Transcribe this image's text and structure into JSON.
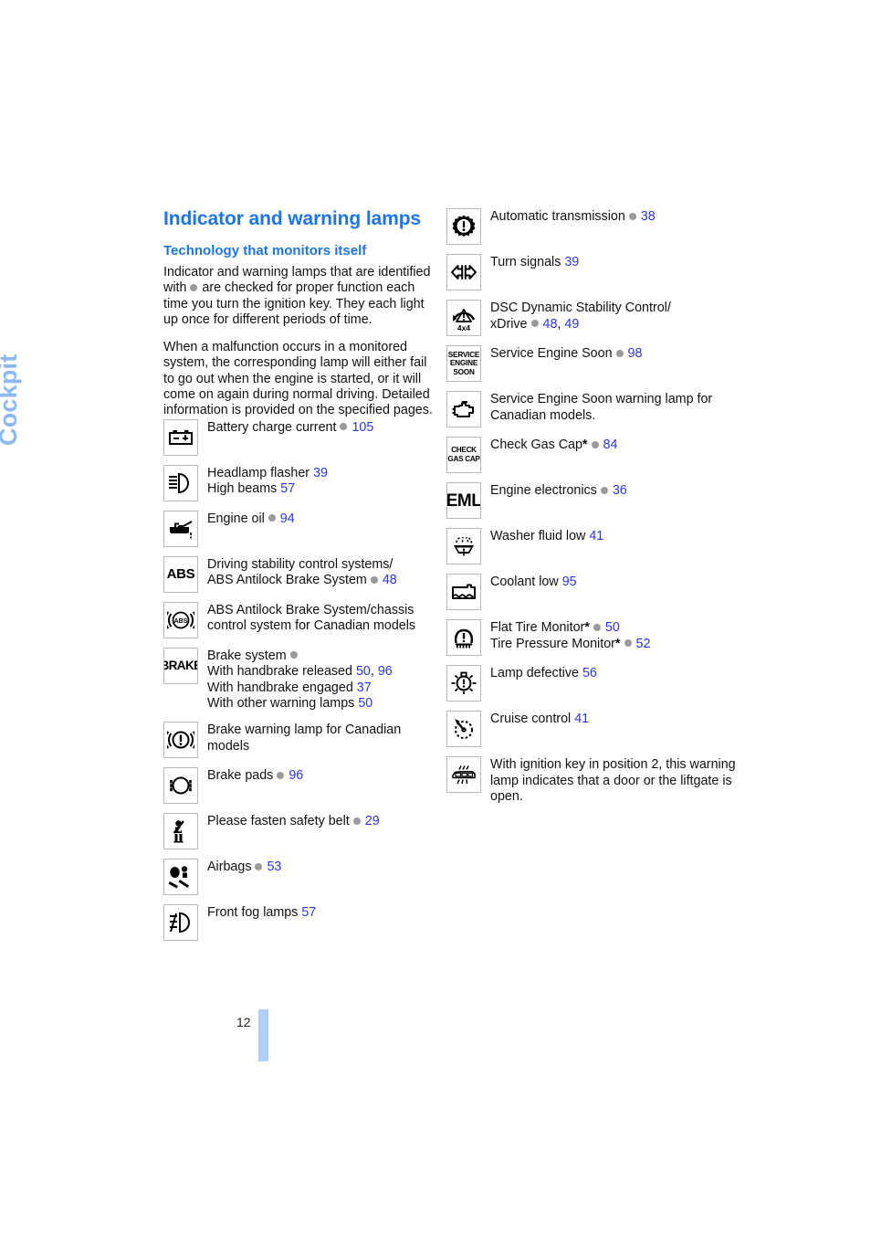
{
  "chapter_tab": "Cockpit",
  "page_number": "12",
  "colors": {
    "heading_blue": "#1E74EA",
    "page_ref_blue": "#2A36DE",
    "tab_blue": "#8CB9F2",
    "footer_bar_blue": "#AFD0F7",
    "bullet_gray": "#9a9a9a"
  },
  "intro": {
    "title": "Indicator and warning lamps",
    "subtitle": "Technology that monitors itself",
    "paragraph1_a": "Indicator and warning lamps that are identified with",
    "paragraph1_b": "are checked for proper function each time you turn the ignition key. They each light up once for different periods of time.",
    "paragraph2": "When a malfunction occurs in a monitored system, the corresponding lamp will either fail to go out when the engine is started, or it will come on again during normal driving. Detailed information is provided on the specified pages."
  },
  "left_column": [
    {
      "icon": "battery-charge-icon",
      "icon_kind": "battery",
      "lines": [
        {
          "label": "Battery charge current",
          "dot": true,
          "pages": "105"
        }
      ]
    },
    {
      "icon": "headlamp-flasher-icon",
      "icon_kind": "headlamp",
      "lines": [
        {
          "label": "Headlamp flasher",
          "dot": false,
          "pages": "39"
        },
        {
          "label": "High beams",
          "dot": false,
          "pages": "57"
        }
      ]
    },
    {
      "icon": "engine-oil-icon",
      "icon_kind": "oilcan",
      "lines": [
        {
          "label": "Engine oil",
          "dot": true,
          "pages": "94"
        }
      ]
    },
    {
      "icon": "abs-text-icon",
      "icon_kind": "text",
      "icon_text": "ABS",
      "icon_text_class": "g-abs",
      "lines": [
        {
          "label": "Driving stability control systems/",
          "dot": false,
          "pages": ""
        },
        {
          "label": "ABS Antilock Brake System",
          "dot": true,
          "pages": "48"
        }
      ]
    },
    {
      "icon": "abs-circle-icon",
      "icon_kind": "abs-circle",
      "lines": [
        {
          "label": "ABS Antilock Brake System/chassis control system for Canadian models",
          "dot": false,
          "pages": ""
        }
      ]
    },
    {
      "icon": "brake-text-icon",
      "icon_kind": "text",
      "icon_text": "BRAKE",
      "icon_text_class": "g-brake",
      "lines": [
        {
          "label": "Brake system",
          "dot": true,
          "pages": ""
        },
        {
          "label": "With handbrake released",
          "dot": false,
          "pages": "50, 96"
        },
        {
          "label": "With handbrake engaged",
          "dot": false,
          "pages": "37"
        },
        {
          "label": "With other warning lamps",
          "dot": false,
          "pages": "50"
        }
      ]
    },
    {
      "icon": "brake-warning-canadian-icon",
      "icon_kind": "brake-exclaim",
      "lines": [
        {
          "label": "Brake warning lamp for Canadian models",
          "dot": false,
          "pages": ""
        }
      ]
    },
    {
      "icon": "brake-pads-icon",
      "icon_kind": "brake-pads",
      "lines": [
        {
          "label": "Brake pads",
          "dot": true,
          "pages": "96"
        }
      ]
    },
    {
      "icon": "safety-belt-icon",
      "icon_kind": "seatbelt",
      "lines": [
        {
          "label": "Please fasten safety belt",
          "dot": true,
          "pages": "29"
        }
      ]
    },
    {
      "icon": "airbag-icon",
      "icon_kind": "airbag",
      "lines": [
        {
          "label": "Airbags",
          "dot": true,
          "pages": "53"
        }
      ]
    },
    {
      "icon": "front-fog-lamp-icon",
      "icon_kind": "foglamp",
      "lines": [
        {
          "label": "Front fog lamps",
          "dot": false,
          "pages": "57"
        }
      ]
    }
  ],
  "right_column": [
    {
      "icon": "automatic-transmission-icon",
      "icon_kind": "gear-exclaim",
      "lines": [
        {
          "label": "Automatic transmission",
          "dot": true,
          "pages": "38"
        }
      ]
    },
    {
      "icon": "turn-signals-icon",
      "icon_kind": "turn-signals",
      "lines": [
        {
          "label": "Turn signals",
          "dot": false,
          "pages": "39"
        }
      ]
    },
    {
      "icon": "dsc-xdrive-icon",
      "icon_kind": "dsc",
      "icon_sub": "4x4",
      "lines": [
        {
          "label": "DSC Dynamic Stability Control/",
          "dot": false,
          "pages": ""
        },
        {
          "label": "xDrive",
          "dot": true,
          "pages": "48, 49"
        }
      ]
    },
    {
      "icon": "service-engine-soon-text-icon",
      "icon_kind": "text",
      "icon_text": "SERVICE\nENGINE\nSOON",
      "icon_text_class": "g-ses",
      "lines": [
        {
          "label": "Service Engine Soon",
          "dot": true,
          "pages": "98"
        }
      ]
    },
    {
      "icon": "check-engine-icon",
      "icon_kind": "engine-block",
      "lines": [
        {
          "label": "Service Engine Soon warning lamp for Canadian models.",
          "dot": false,
          "pages": ""
        }
      ]
    },
    {
      "icon": "check-gas-cap-text-icon",
      "icon_kind": "text",
      "icon_text": "CHECK\nGAS CAP",
      "icon_text_class": "g-cgc",
      "lines": [
        {
          "label": "Check Gas Cap",
          "star": true,
          "dot": true,
          "pages": "84"
        }
      ]
    },
    {
      "icon": "eml-text-icon",
      "icon_kind": "text",
      "icon_text": "EML",
      "icon_text_class": "g-eml",
      "lines": [
        {
          "label": "Engine electronics",
          "dot": true,
          "pages": "36"
        }
      ]
    },
    {
      "icon": "washer-fluid-icon",
      "icon_kind": "washer",
      "lines": [
        {
          "label": "Washer fluid low",
          "dot": false,
          "pages": "41"
        }
      ]
    },
    {
      "icon": "coolant-low-icon",
      "icon_kind": "coolant",
      "lines": [
        {
          "label": "Coolant low",
          "dot": false,
          "pages": "95"
        }
      ]
    },
    {
      "icon": "tire-pressure-icon",
      "icon_kind": "tire",
      "lines": [
        {
          "label": "Flat Tire Monitor",
          "star": true,
          "dot": true,
          "pages": "50"
        },
        {
          "label": "Tire Pressure Monitor",
          "star": true,
          "dot": true,
          "pages": "52"
        }
      ]
    },
    {
      "icon": "lamp-defective-icon",
      "icon_kind": "bulb",
      "lines": [
        {
          "label": "Lamp defective",
          "dot": false,
          "pages": "56"
        }
      ]
    },
    {
      "icon": "cruise-control-icon",
      "icon_kind": "cruise",
      "lines": [
        {
          "label": "Cruise control",
          "dot": false,
          "pages": "41"
        }
      ]
    },
    {
      "icon": "door-open-icon",
      "icon_kind": "car-doors",
      "lines": [
        {
          "label": "With ignition key in position 2, this warning lamp indicates that a door or the liftgate is open.",
          "dot": false,
          "pages": ""
        }
      ]
    }
  ]
}
